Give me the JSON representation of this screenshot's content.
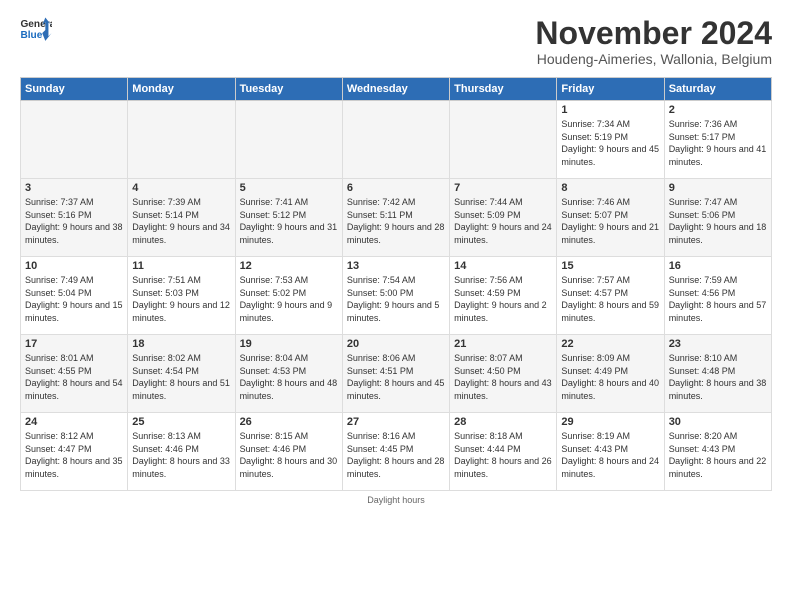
{
  "logo": {
    "text_general": "General",
    "text_blue": "Blue"
  },
  "title": "November 2024",
  "subtitle": "Houdeng-Aimeries, Wallonia, Belgium",
  "days_of_week": [
    "Sunday",
    "Monday",
    "Tuesday",
    "Wednesday",
    "Thursday",
    "Friday",
    "Saturday"
  ],
  "footer": "Daylight hours",
  "weeks": [
    [
      {
        "day": "",
        "empty": true
      },
      {
        "day": "",
        "empty": true
      },
      {
        "day": "",
        "empty": true
      },
      {
        "day": "",
        "empty": true
      },
      {
        "day": "",
        "empty": true
      },
      {
        "day": "1",
        "rise": "7:34 AM",
        "set": "5:19 PM",
        "daylight": "9 hours and 45 minutes."
      },
      {
        "day": "2",
        "rise": "7:36 AM",
        "set": "5:17 PM",
        "daylight": "9 hours and 41 minutes."
      }
    ],
    [
      {
        "day": "3",
        "rise": "7:37 AM",
        "set": "5:16 PM",
        "daylight": "9 hours and 38 minutes."
      },
      {
        "day": "4",
        "rise": "7:39 AM",
        "set": "5:14 PM",
        "daylight": "9 hours and 34 minutes."
      },
      {
        "day": "5",
        "rise": "7:41 AM",
        "set": "5:12 PM",
        "daylight": "9 hours and 31 minutes."
      },
      {
        "day": "6",
        "rise": "7:42 AM",
        "set": "5:11 PM",
        "daylight": "9 hours and 28 minutes."
      },
      {
        "day": "7",
        "rise": "7:44 AM",
        "set": "5:09 PM",
        "daylight": "9 hours and 24 minutes."
      },
      {
        "day": "8",
        "rise": "7:46 AM",
        "set": "5:07 PM",
        "daylight": "9 hours and 21 minutes."
      },
      {
        "day": "9",
        "rise": "7:47 AM",
        "set": "5:06 PM",
        "daylight": "9 hours and 18 minutes."
      }
    ],
    [
      {
        "day": "10",
        "rise": "7:49 AM",
        "set": "5:04 PM",
        "daylight": "9 hours and 15 minutes."
      },
      {
        "day": "11",
        "rise": "7:51 AM",
        "set": "5:03 PM",
        "daylight": "9 hours and 12 minutes."
      },
      {
        "day": "12",
        "rise": "7:53 AM",
        "set": "5:02 PM",
        "daylight": "9 hours and 9 minutes."
      },
      {
        "day": "13",
        "rise": "7:54 AM",
        "set": "5:00 PM",
        "daylight": "9 hours and 5 minutes."
      },
      {
        "day": "14",
        "rise": "7:56 AM",
        "set": "4:59 PM",
        "daylight": "9 hours and 2 minutes."
      },
      {
        "day": "15",
        "rise": "7:57 AM",
        "set": "4:57 PM",
        "daylight": "8 hours and 59 minutes."
      },
      {
        "day": "16",
        "rise": "7:59 AM",
        "set": "4:56 PM",
        "daylight": "8 hours and 57 minutes."
      }
    ],
    [
      {
        "day": "17",
        "rise": "8:01 AM",
        "set": "4:55 PM",
        "daylight": "8 hours and 54 minutes."
      },
      {
        "day": "18",
        "rise": "8:02 AM",
        "set": "4:54 PM",
        "daylight": "8 hours and 51 minutes."
      },
      {
        "day": "19",
        "rise": "8:04 AM",
        "set": "4:53 PM",
        "daylight": "8 hours and 48 minutes."
      },
      {
        "day": "20",
        "rise": "8:06 AM",
        "set": "4:51 PM",
        "daylight": "8 hours and 45 minutes."
      },
      {
        "day": "21",
        "rise": "8:07 AM",
        "set": "4:50 PM",
        "daylight": "8 hours and 43 minutes."
      },
      {
        "day": "22",
        "rise": "8:09 AM",
        "set": "4:49 PM",
        "daylight": "8 hours and 40 minutes."
      },
      {
        "day": "23",
        "rise": "8:10 AM",
        "set": "4:48 PM",
        "daylight": "8 hours and 38 minutes."
      }
    ],
    [
      {
        "day": "24",
        "rise": "8:12 AM",
        "set": "4:47 PM",
        "daylight": "8 hours and 35 minutes."
      },
      {
        "day": "25",
        "rise": "8:13 AM",
        "set": "4:46 PM",
        "daylight": "8 hours and 33 minutes."
      },
      {
        "day": "26",
        "rise": "8:15 AM",
        "set": "4:46 PM",
        "daylight": "8 hours and 30 minutes."
      },
      {
        "day": "27",
        "rise": "8:16 AM",
        "set": "4:45 PM",
        "daylight": "8 hours and 28 minutes."
      },
      {
        "day": "28",
        "rise": "8:18 AM",
        "set": "4:44 PM",
        "daylight": "8 hours and 26 minutes."
      },
      {
        "day": "29",
        "rise": "8:19 AM",
        "set": "4:43 PM",
        "daylight": "8 hours and 24 minutes."
      },
      {
        "day": "30",
        "rise": "8:20 AM",
        "set": "4:43 PM",
        "daylight": "8 hours and 22 minutes."
      }
    ]
  ]
}
